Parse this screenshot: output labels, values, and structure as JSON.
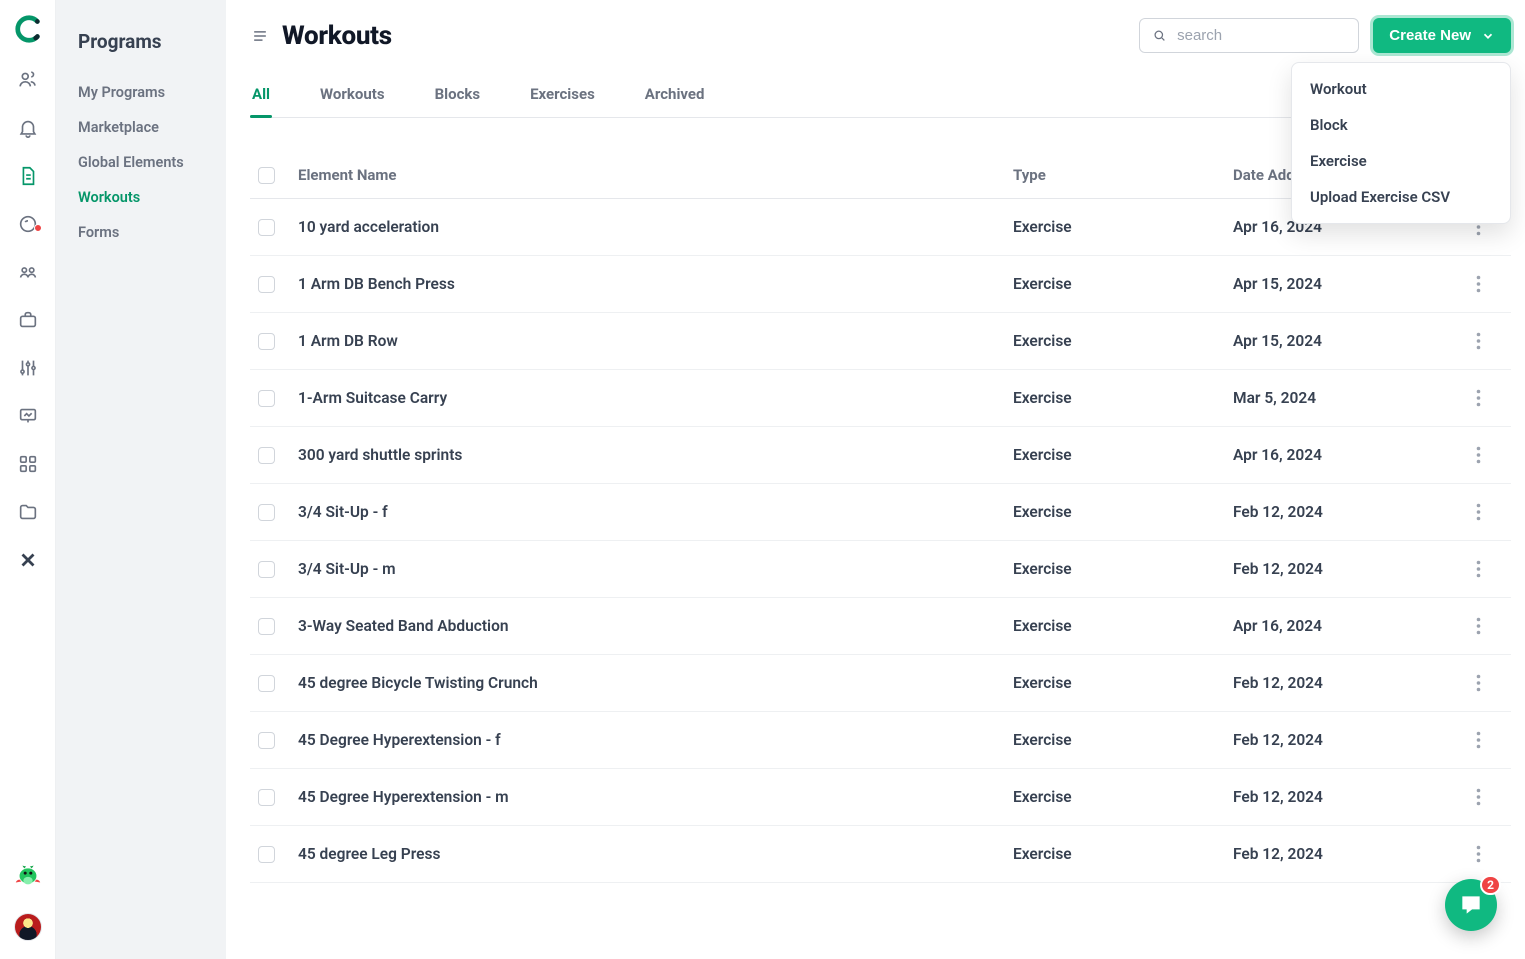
{
  "sidebar": {
    "title": "Programs",
    "items": [
      {
        "label": "My Programs"
      },
      {
        "label": "Marketplace"
      },
      {
        "label": "Global Elements"
      },
      {
        "label": "Workouts"
      },
      {
        "label": "Forms"
      }
    ]
  },
  "header": {
    "title": "Workouts",
    "search_placeholder": "search",
    "create_label": "Create New"
  },
  "dropdown": {
    "items": [
      {
        "label": "Workout"
      },
      {
        "label": "Block"
      },
      {
        "label": "Exercise"
      },
      {
        "label": "Upload Exercise CSV"
      }
    ]
  },
  "tabs": [
    {
      "label": "All"
    },
    {
      "label": "Workouts"
    },
    {
      "label": "Blocks"
    },
    {
      "label": "Exercises"
    },
    {
      "label": "Archived"
    }
  ],
  "table": {
    "headers": {
      "name": "Element Name",
      "type": "Type",
      "date": "Date Added"
    },
    "rows": [
      {
        "name": "10 yard acceleration",
        "type": "Exercise",
        "date": "Apr 16, 2024"
      },
      {
        "name": "1 Arm DB Bench Press",
        "type": "Exercise",
        "date": "Apr 15, 2024"
      },
      {
        "name": "1 Arm DB Row",
        "type": "Exercise",
        "date": "Apr 15, 2024"
      },
      {
        "name": "1-Arm Suitcase Carry",
        "type": "Exercise",
        "date": "Mar 5, 2024"
      },
      {
        "name": "300 yard shuttle sprints",
        "type": "Exercise",
        "date": "Apr 16, 2024"
      },
      {
        "name": "3/4 Sit-Up - f",
        "type": "Exercise",
        "date": "Feb 12, 2024"
      },
      {
        "name": "3/4 Sit-Up - m",
        "type": "Exercise",
        "date": "Feb 12, 2024"
      },
      {
        "name": "3-Way Seated Band Abduction",
        "type": "Exercise",
        "date": "Apr 16, 2024"
      },
      {
        "name": "45 degree Bicycle Twisting Crunch",
        "type": "Exercise",
        "date": "Feb 12, 2024"
      },
      {
        "name": "45 Degree Hyperextension - f",
        "type": "Exercise",
        "date": "Feb 12, 2024"
      },
      {
        "name": "45 Degree Hyperextension - m",
        "type": "Exercise",
        "date": "Feb 12, 2024"
      },
      {
        "name": "45 degree Leg Press",
        "type": "Exercise",
        "date": "Feb 12, 2024"
      }
    ]
  },
  "chat": {
    "badge": "2"
  }
}
